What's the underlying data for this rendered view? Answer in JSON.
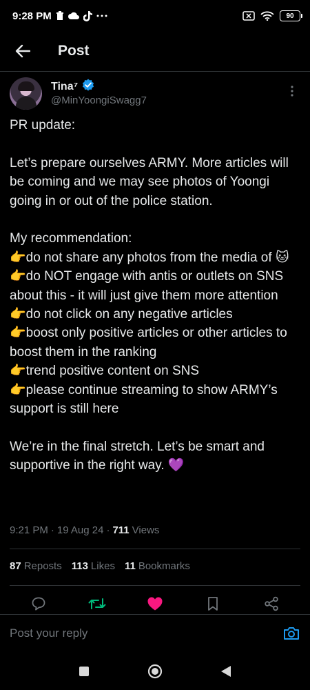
{
  "status_bar": {
    "time": "9:28 PM",
    "battery": "90",
    "icons": [
      "trash-icon",
      "cloud-icon",
      "tiktok-icon",
      "more-dots-icon",
      "sim-icon",
      "wifi-icon",
      "battery-icon"
    ]
  },
  "header": {
    "title": "Post",
    "back_icon": "arrow-left-icon"
  },
  "author": {
    "name": "Tina⁷",
    "handle": "@MinYoongiSwagg7",
    "verified_icon": "verified-badge-icon",
    "verified_color": "#1d9bf0"
  },
  "post": {
    "lines": [
      "PR update:",
      "",
      "Let’s prepare ourselves ARMY. More articles will be coming and we may see photos of Yoongi going in or out of the police station.",
      "",
      "My recommendation:",
      "👉do not share any photos from the media of 🐱",
      "👉do NOT engage with antis or outlets on SNS about this - it will just give them more attention",
      "👉do not click on any negative articles",
      "👉boost only positive articles or other articles to boost them in the ranking",
      "👉trend positive content on SNS",
      "👉please continue streaming to show ARMY’s support is still here",
      "",
      "We’re in the final stretch. Let’s be smart and supportive in the right way. 💜"
    ]
  },
  "meta": {
    "time": "9:21 PM",
    "separator": "·",
    "date": "19 Aug 24",
    "views_count": "711",
    "views_label": "Views"
  },
  "stats": {
    "reposts_count": "87",
    "reposts_label": "Reposts",
    "likes_count": "113",
    "likes_label": "Likes",
    "bookmarks_count": "11",
    "bookmarks_label": "Bookmarks"
  },
  "actions": {
    "icons": [
      "reply-icon",
      "repost-icon",
      "like-icon",
      "bookmark-icon",
      "share-icon"
    ],
    "repost_color": "#00ba7c",
    "like_color": "#f91880"
  },
  "reply": {
    "placeholder": "Post your reply",
    "camera_icon": "camera-icon",
    "camera_color": "#1d9bf0"
  },
  "nav": {
    "icons": [
      "recents-icon",
      "home-icon",
      "back-icon"
    ]
  }
}
